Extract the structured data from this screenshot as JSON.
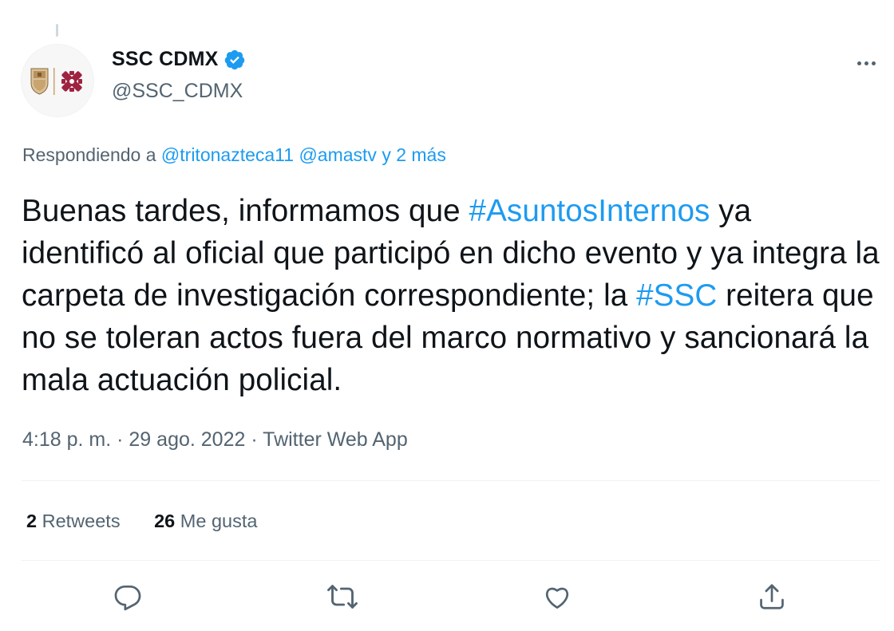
{
  "author": {
    "display_name": "SSC CDMX",
    "handle": "@SSC_CDMX",
    "avatar_icon": "ssc-cdmx-logo",
    "verified_icon": "verified-badge-icon"
  },
  "replying": {
    "prefix": "Respondiendo a",
    "mentions": [
      "@tritonazteca11",
      "@amastv"
    ],
    "suffix": "y 2 más"
  },
  "tweet": {
    "part1": "Buenas tardes, informamos que ",
    "hashtag1": "#AsuntosInternos",
    "part2": " ya identificó al oficial que participó en dicho evento y ya integra la carpeta de investigación correspondiente; la ",
    "hashtag2": "#SSC",
    "part3": " reitera que no se toleran actos fuera del marco normativo y sancionará la mala actuación policial."
  },
  "meta": {
    "time": "4:18 p. m.",
    "sep": "·",
    "date": "29 ago. 2022",
    "app": "Twitter Web App"
  },
  "stats": {
    "retweets_count": "2",
    "retweets_label": "Retweets",
    "likes_count": "26",
    "likes_label": "Me gusta"
  },
  "actions": [
    "reply-icon",
    "retweet-icon",
    "like-icon",
    "share-icon"
  ],
  "colors": {
    "link": "#1d9bf0",
    "secondary": "#536471",
    "verified": "#1d9bf0",
    "logo_maroon": "#9f2241",
    "logo_gold": "#bc955c"
  }
}
